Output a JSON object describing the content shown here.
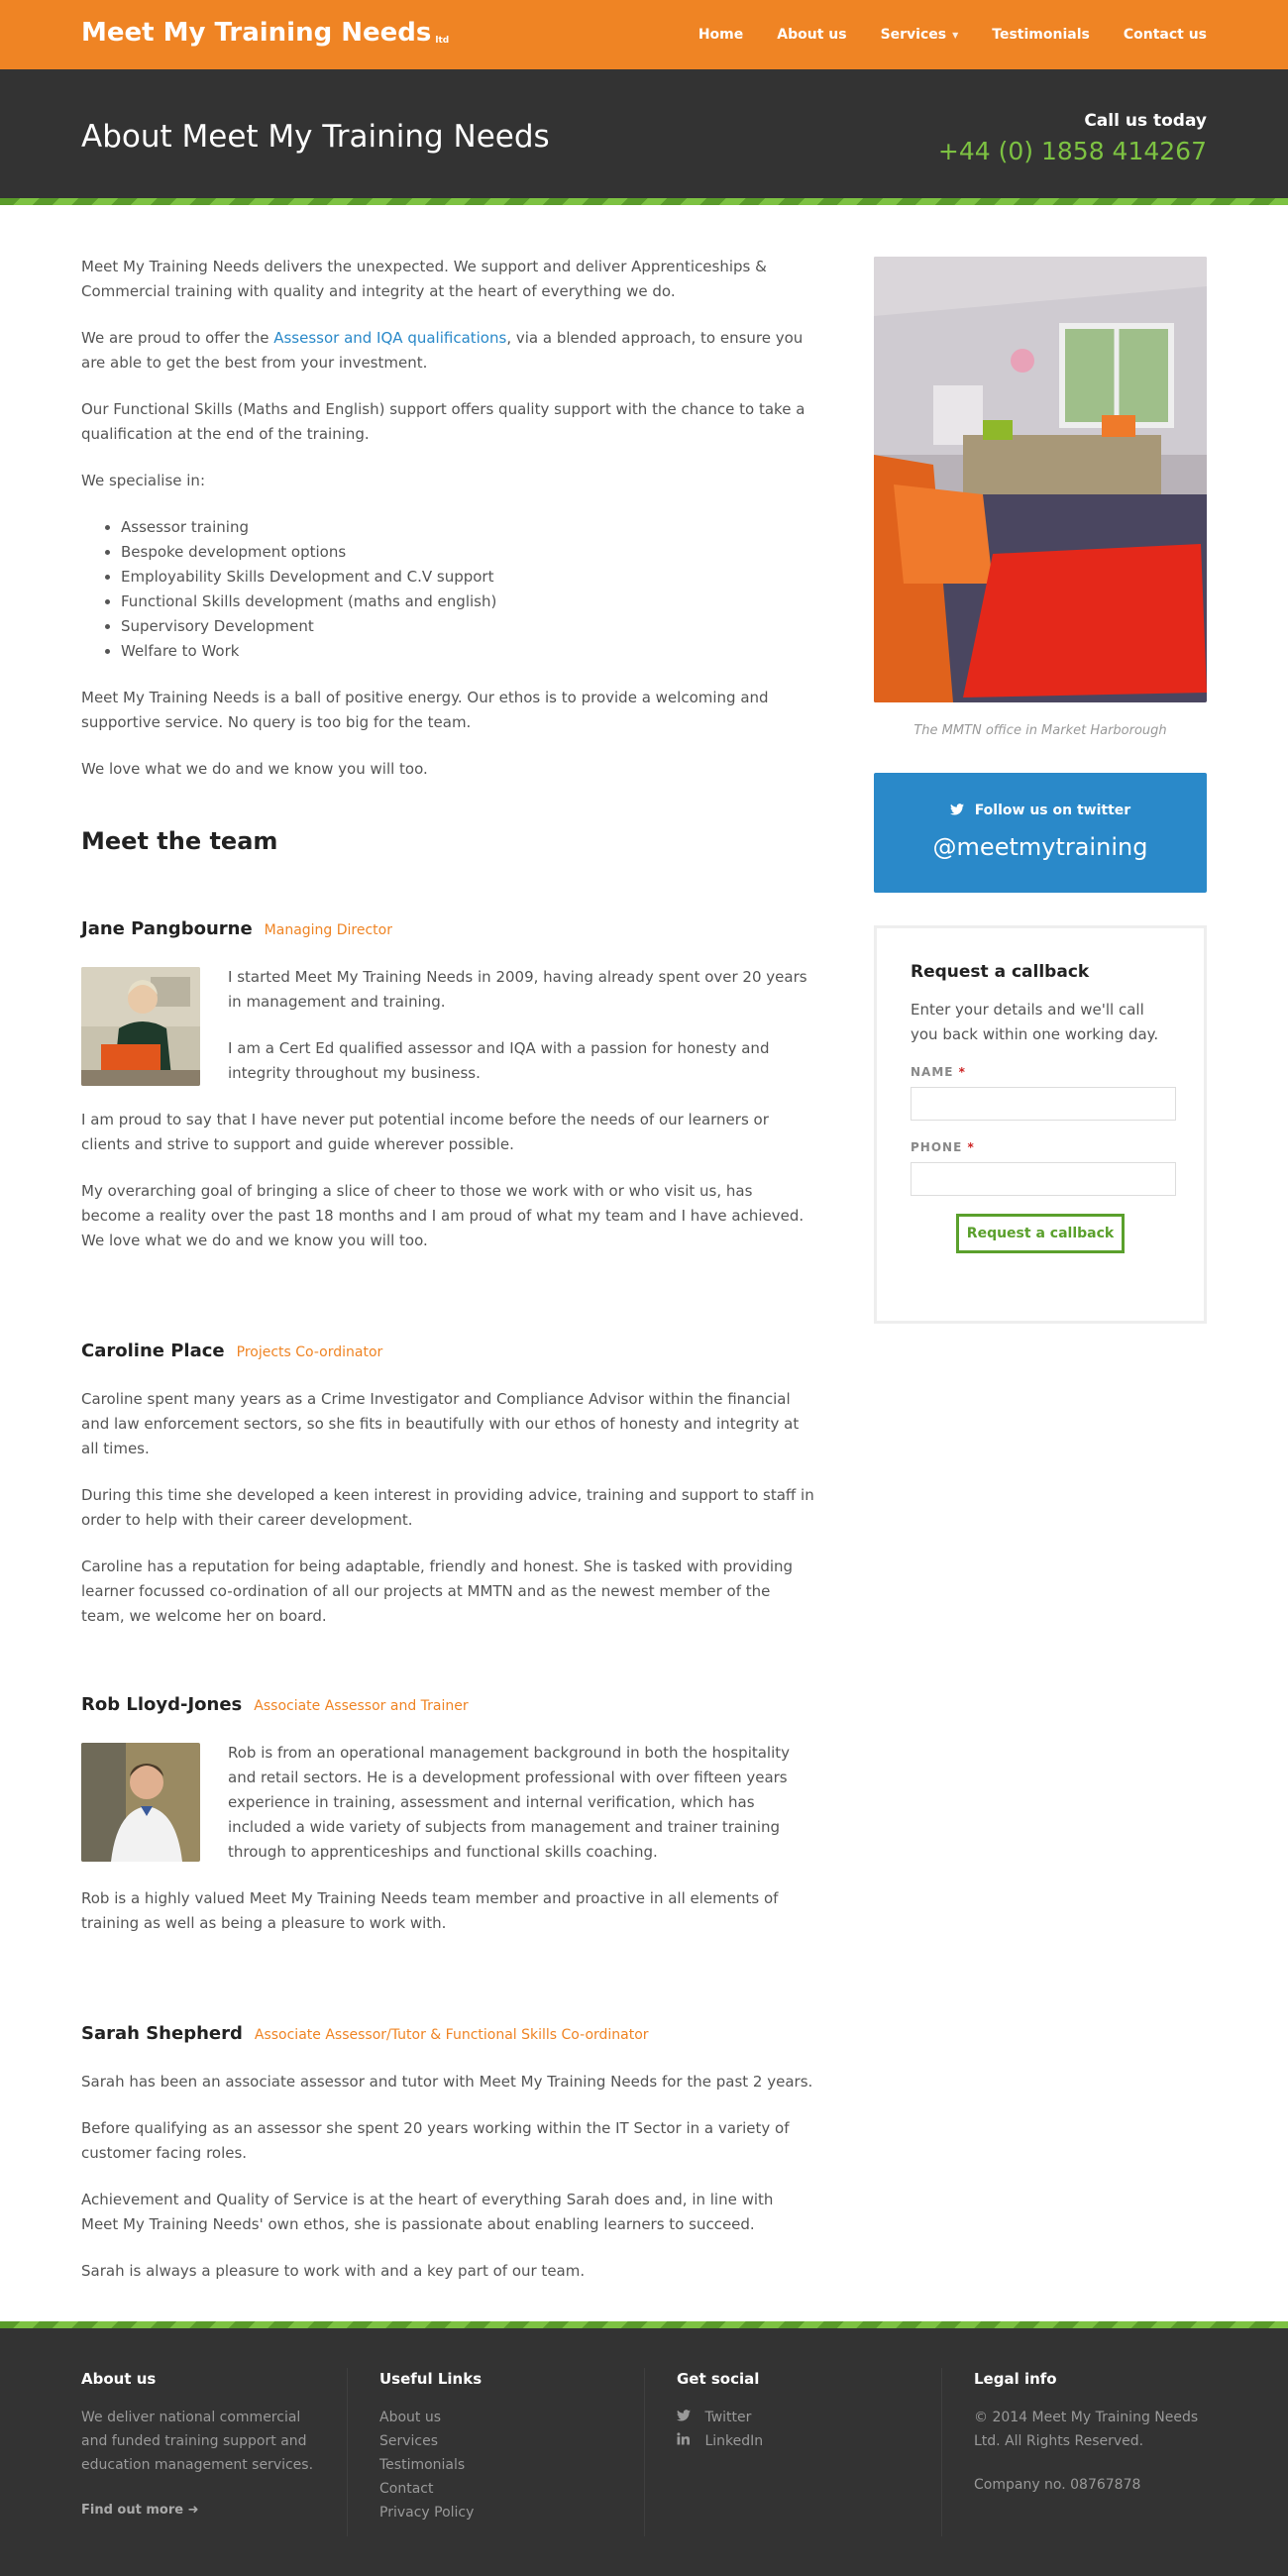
{
  "header": {
    "logo": "Meet My Training Needs",
    "logo_suffix": "ltd",
    "nav": [
      {
        "label": "Home"
      },
      {
        "label": "About us"
      },
      {
        "label": "Services"
      },
      {
        "label": "Testimonials"
      },
      {
        "label": "Contact us"
      }
    ]
  },
  "title_band": {
    "title": "About Meet My Training Needs",
    "call_label": "Call us today",
    "phone": "+44 (0) 1858 414267"
  },
  "intro": {
    "p1": "Meet My Training Needs delivers the unexpected. We support and deliver Apprenticeships & Commercial training with quality and integrity at the heart of everything we do.",
    "p2_before": "We are proud to offer the ",
    "p2_link": "Assessor and IQA qualifications",
    "p2_after": ", via a blended approach, to ensure you are able to get the best from your investment.",
    "p3": "Our Functional Skills (Maths and English) support offers quality support with the chance to take a qualification at the end of the training.",
    "p4": "We specialise in:",
    "specialisms": [
      "Assessor training",
      "Bespoke development options",
      "Employability Skills Development and C.V support",
      "Functional Skills development (maths and english)",
      "Supervisory Development",
      "Welfare to Work"
    ],
    "p5": "Meet My Training Needs is a ball of positive energy. Our ethos is to provide a welcoming and supportive service. No query is too big for the team.",
    "p6": "We love what we do and we know you will too."
  },
  "team": {
    "heading": "Meet the team",
    "jane": {
      "name": "Jane Pangbourne",
      "role": "Managing Director",
      "p1": "I started Meet My Training Needs in 2009, having already spent over 20 years in management and training.",
      "p2": "I am a Cert Ed qualified assessor and IQA with a passion for honesty and integrity throughout my business.",
      "p3": "I am proud to say that I have never put potential income before the needs of our learners or clients and strive to support and guide wherever possible.",
      "p4": "My overarching goal of bringing a slice of cheer to those we work with or who visit us, has become a reality over the past 18 months and I am proud of what my team and I have achieved. We love what we do and we know you will too."
    },
    "caroline": {
      "name": "Caroline Place",
      "role": "Projects Co-ordinator",
      "p1": "Caroline spent many years as a Crime Investigator and Compliance Advisor within the financial and law enforcement sectors, so she fits in beautifully with our ethos of honesty and integrity at all times.",
      "p2": "During this time she developed a keen interest in providing advice, training and support to staff in order to help with their career development.",
      "p3": "Caroline has a reputation for being adaptable, friendly and honest. She is tasked with providing learner focussed co-ordination of all our projects at MMTN and as the newest member of the team, we welcome her on board."
    },
    "rob": {
      "name": "Rob Lloyd-Jones",
      "role": "Associate Assessor and Trainer",
      "p1": "Rob is from an operational management background in both the hospitality and retail sectors. He is a development professional with over fifteen years experience in training, assessment and internal verification, which has included a wide variety of subjects from management and trainer training through to apprenticeships and functional skills coaching.",
      "p2": "Rob is a highly valued Meet My Training Needs team member and proactive in all elements of training as well as being a pleasure to work with."
    },
    "sarah": {
      "name": "Sarah Shepherd",
      "role": "Associate Assessor/Tutor & Functional Skills Co-ordinator",
      "p1": "Sarah has been an associate assessor and tutor with Meet My Training Needs for the past 2 years.",
      "p2": "Before qualifying as an assessor she spent 20 years working within the IT Sector in a variety of customer facing roles.",
      "p3": "Achievement and Quality of Service is at the heart of everything Sarah does and, in line with Meet My Training Needs' own ethos, she is passionate about enabling learners to succeed.",
      "p4": "Sarah is always a pleasure to work with and a key part of our team."
    }
  },
  "sidebar": {
    "office_caption": "The MMTN office in Market Harborough",
    "twitter_label": "Follow us on twitter",
    "twitter_handle": "@meetmytraining",
    "callback": {
      "title": "Request a callback",
      "text": "Enter your details and we'll call you back within one working day.",
      "name_label": "NAME",
      "phone_label": "PHONE",
      "required_mark": "*",
      "button": "Request a callback"
    }
  },
  "footer": {
    "about": {
      "title": "About us",
      "text": "We deliver national commercial and funded training support and education management services.",
      "link": "Find out more"
    },
    "links": {
      "title": "Useful Links",
      "items": [
        "About us",
        "Services",
        "Testimonials",
        "Contact",
        "Privacy Policy"
      ]
    },
    "social": {
      "title": "Get social",
      "twitter": "Twitter",
      "linkedin": "LinkedIn"
    },
    "legal": {
      "title": "Legal info",
      "copyright": "© 2014 Meet My Training Needs Ltd. All Rights Reserved.",
      "company": "Company no. 08767878"
    }
  },
  "colors": {
    "brand_orange": "#ef8424",
    "dark": "#333333",
    "green": "#7dc242",
    "twitter_blue": "#2a89c9"
  }
}
